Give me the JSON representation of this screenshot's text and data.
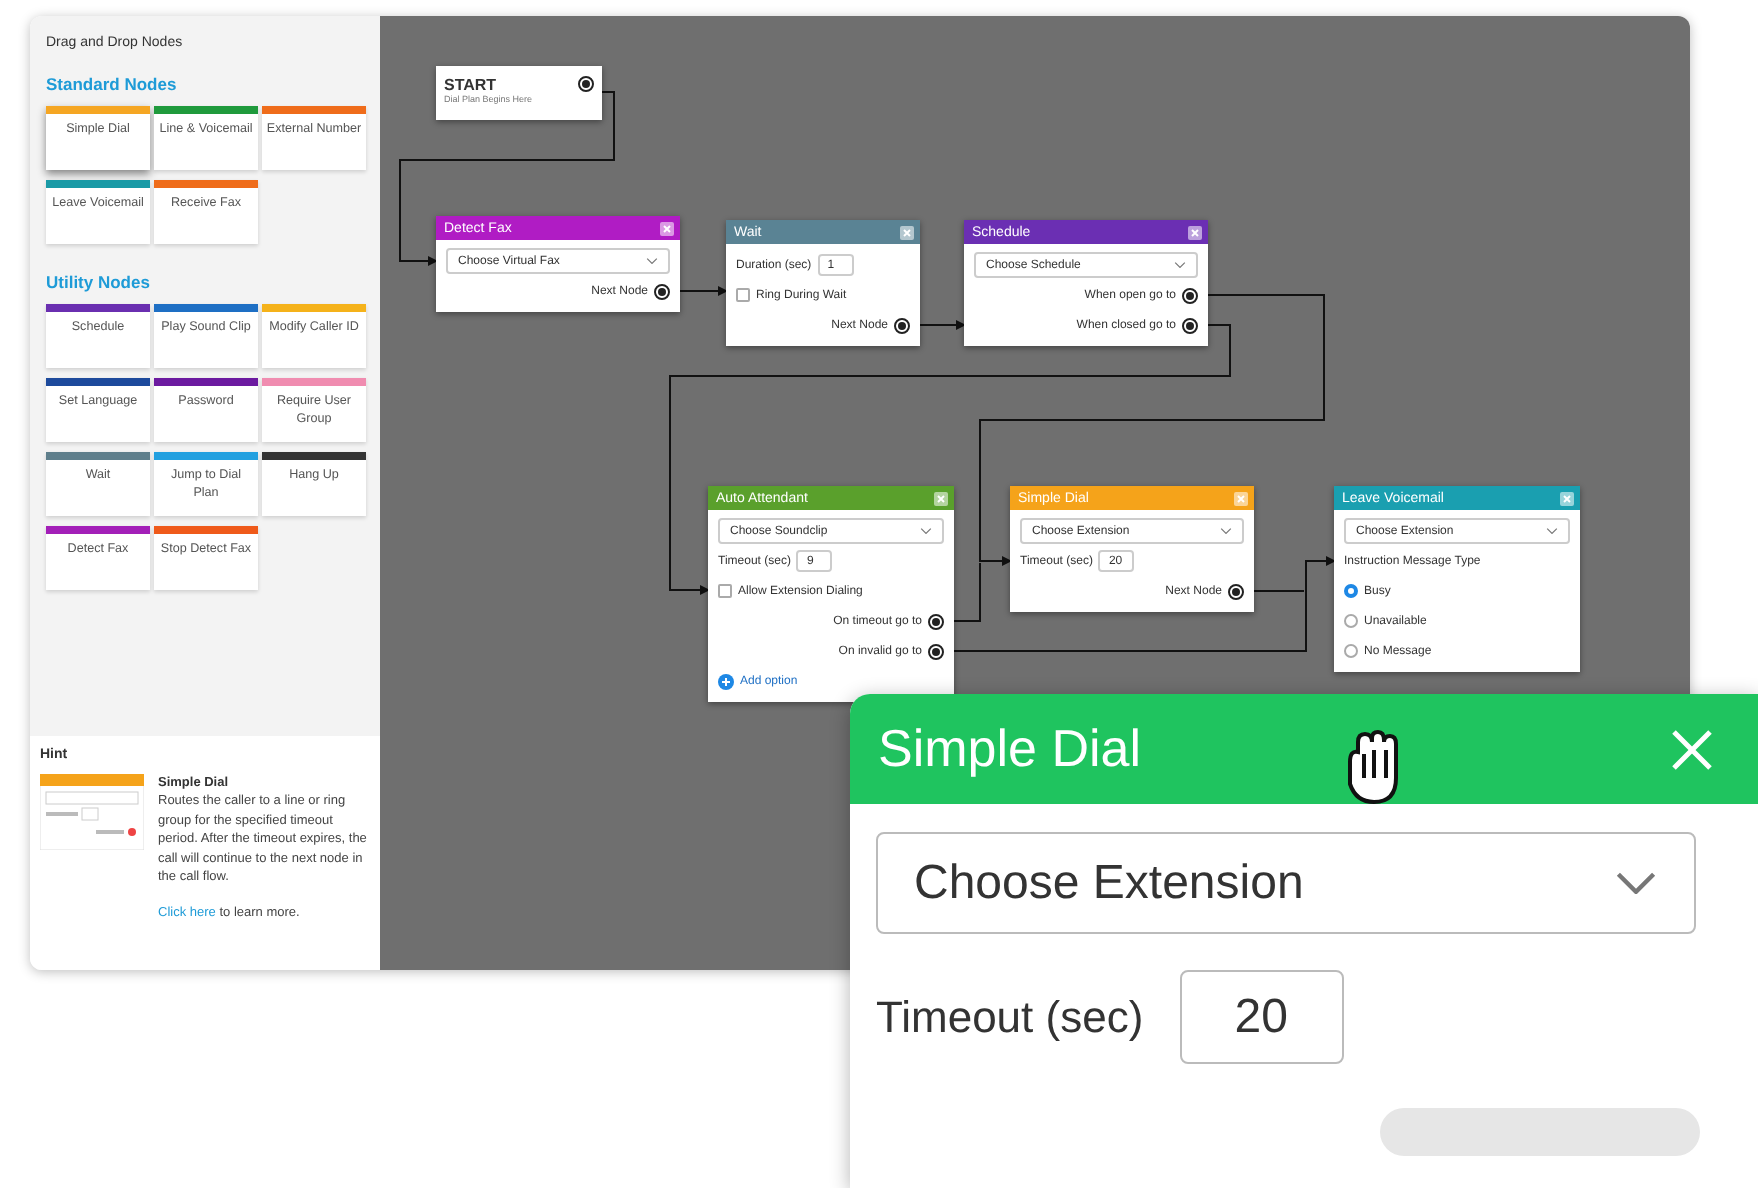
{
  "sidebar": {
    "title": "Drag and Drop Nodes",
    "sections": [
      {
        "heading": "Standard Nodes",
        "tiles": [
          {
            "label": "Simple Dial",
            "color": "#f5a623",
            "selected": true
          },
          {
            "label": "Line & Voicemail",
            "color": "#1f9a3c",
            "selected": false
          },
          {
            "label": "External Number",
            "color": "#ef6c1a",
            "selected": false
          },
          {
            "label": "Leave Voicemail",
            "color": "#1a9aa6",
            "selected": false
          },
          {
            "label": "Receive Fax",
            "color": "#ef6c1a",
            "selected": false
          }
        ]
      },
      {
        "heading": "Utility Nodes",
        "tiles": [
          {
            "label": "Schedule",
            "color": "#6a2fb0",
            "selected": false
          },
          {
            "label": "Play Sound Clip",
            "color": "#1e6fc4",
            "selected": false
          },
          {
            "label": "Modify Caller ID",
            "color": "#f5b21a",
            "selected": false
          },
          {
            "label": "Set Language",
            "color": "#1d4a9c",
            "selected": false
          },
          {
            "label": "Password",
            "color": "#6c1aa0",
            "selected": false
          },
          {
            "label": "Require User Group",
            "color": "#f08cb0",
            "selected": false
          },
          {
            "label": "Wait",
            "color": "#5f7f8c",
            "selected": false
          },
          {
            "label": "Jump to Dial Plan",
            "color": "#22a0e0",
            "selected": false
          },
          {
            "label": "Hang Up",
            "color": "#333333",
            "selected": false
          },
          {
            "label": "Detect Fax",
            "color": "#a31fb8",
            "selected": false
          },
          {
            "label": "Stop Detect Fax",
            "color": "#ef5a1a",
            "selected": false
          }
        ]
      }
    ],
    "hint": {
      "title": "Hint",
      "node_title": "Simple Dial",
      "description": "Routes the caller to a line or ring group for the specified timeout period. After the timeout expires, the call will continue to the next node in the call flow.",
      "link": "Click here",
      "link_suffix": "to learn more."
    }
  },
  "canvas": {
    "nodes": [
      {
        "kind": "start",
        "title": "START",
        "subtitle": "Dial Plan Begins Here"
      },
      {
        "kind": "node",
        "title": "Detect Fax",
        "color": "#b01cc4",
        "rows": [
          {
            "kind": "select",
            "label": "Choose Virtual Fax"
          },
          {
            "kind": "output",
            "label": "Next Node"
          }
        ]
      },
      {
        "kind": "node",
        "title": "Wait",
        "color": "#5a8394",
        "rows": [
          {
            "kind": "number",
            "label": "Duration (sec)",
            "value": "1"
          },
          {
            "kind": "checkbox",
            "label": "Ring During Wait",
            "checked": false
          },
          {
            "kind": "output",
            "label": "Next Node"
          }
        ]
      },
      {
        "kind": "node",
        "title": "Schedule",
        "color": "#6b2fb3",
        "rows": [
          {
            "kind": "select",
            "label": "Choose Schedule"
          },
          {
            "kind": "output",
            "label": "When open go to"
          },
          {
            "kind": "output",
            "label": "When closed go to"
          }
        ]
      },
      {
        "kind": "node",
        "title": "Auto Attendant",
        "color": "#5aa02c",
        "rows": [
          {
            "kind": "select",
            "label": "Choose Soundclip"
          },
          {
            "kind": "number",
            "label": "Timeout (sec)",
            "value": "9"
          },
          {
            "kind": "checkbox",
            "label": "Allow Extension Dialing",
            "checked": false
          },
          {
            "kind": "output",
            "label": "On timeout go to"
          },
          {
            "kind": "output",
            "label": "On invalid go to"
          },
          {
            "kind": "add",
            "label": "Add option"
          }
        ]
      },
      {
        "kind": "node",
        "title": "Simple Dial",
        "color": "#f5a31a",
        "rows": [
          {
            "kind": "select",
            "label": "Choose Extension"
          },
          {
            "kind": "number",
            "label": "Timeout (sec)",
            "value": "20"
          },
          {
            "kind": "output",
            "label": "Next Node"
          }
        ]
      },
      {
        "kind": "node",
        "title": "Leave Voicemail",
        "color": "#1a9fb0",
        "rows": [
          {
            "kind": "select",
            "label": "Choose Extension"
          },
          {
            "kind": "text",
            "label": "Instruction Message Type"
          },
          {
            "kind": "radio",
            "label": "Busy",
            "selected": true
          },
          {
            "kind": "radio",
            "label": "Unavailable",
            "selected": false
          },
          {
            "kind": "radio",
            "label": "No Message",
            "selected": false
          }
        ]
      }
    ]
  },
  "zoom_panel": {
    "title": "Simple Dial",
    "select": "Choose Extension",
    "timeout_label": "Timeout (sec)",
    "timeout_value": "20"
  }
}
